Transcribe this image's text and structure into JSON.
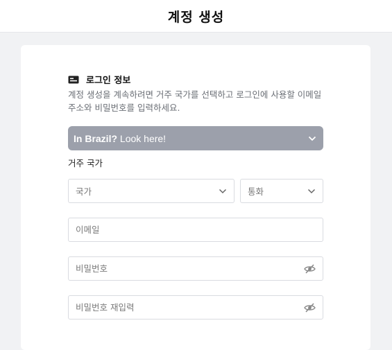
{
  "header": {
    "title": "계정 생성"
  },
  "login_info": {
    "icon": "id-card-icon",
    "title": "로그인 정보",
    "description": "계정 생성을 계속하려면 거주 국가를 선택하고 로그인에 사용할 이메일 주소와 비밀번호를 입력하세요."
  },
  "promo": {
    "bold": "In Brazil?",
    "text": " Look here!",
    "icon": "chevron-down-icon",
    "color": "#9ca0ab"
  },
  "residence": {
    "label": "거주 국가",
    "country_placeholder": "국가",
    "currency_placeholder": "통화"
  },
  "form": {
    "email_placeholder": "이메일",
    "password_placeholder": "비밀번호",
    "password_confirm_placeholder": "비밀번호 재입력",
    "toggle_icon": "eye-slash-icon"
  }
}
